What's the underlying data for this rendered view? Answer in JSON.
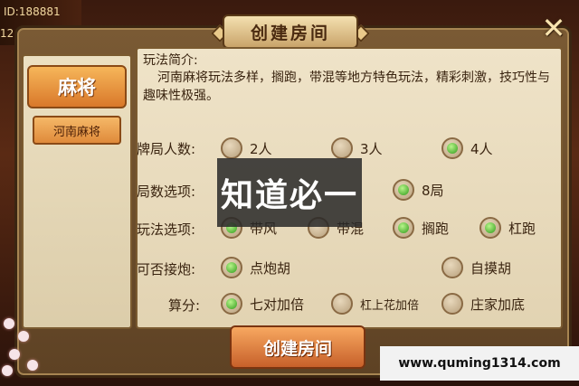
{
  "hud": {
    "player_id": "ID:188881",
    "sub_value": "12"
  },
  "dialog": {
    "title": "创建房间",
    "close_icon": "close-x-icon"
  },
  "left_panel": {
    "game_tab": "麻将",
    "sub_tab": "河南麻将"
  },
  "intro": {
    "title": "玩法简介:",
    "text": "河南麻将玩法多样，搁跑，带混等地方特色玩法，精彩刺激，技巧性与趣味性极强。"
  },
  "options": {
    "players": {
      "label": "牌局人数:",
      "choices": [
        "2人",
        "3人",
        "4人"
      ],
      "selected": "4人"
    },
    "rounds": {
      "label": "局数选项:",
      "choices": [
        "8局"
      ],
      "selected": "8局"
    },
    "play": {
      "label": "玩法选项:",
      "choices": [
        "带风",
        "带混",
        "搁跑",
        "杠跑"
      ],
      "selected": [
        "带风",
        "搁跑",
        "杠跑"
      ]
    },
    "discard": {
      "label": "可否接炮:",
      "choices": [
        "点炮胡",
        "自摸胡"
      ],
      "selected": "点炮胡"
    },
    "scoring": {
      "label": "算分:",
      "choices": [
        "七对加倍",
        "杠上花加倍",
        "庄家加底"
      ],
      "selected": [
        "七对加倍"
      ]
    }
  },
  "create_button": "创建房间",
  "watermark": {
    "text": "知道必一",
    "url": "www.quming1314.com"
  }
}
